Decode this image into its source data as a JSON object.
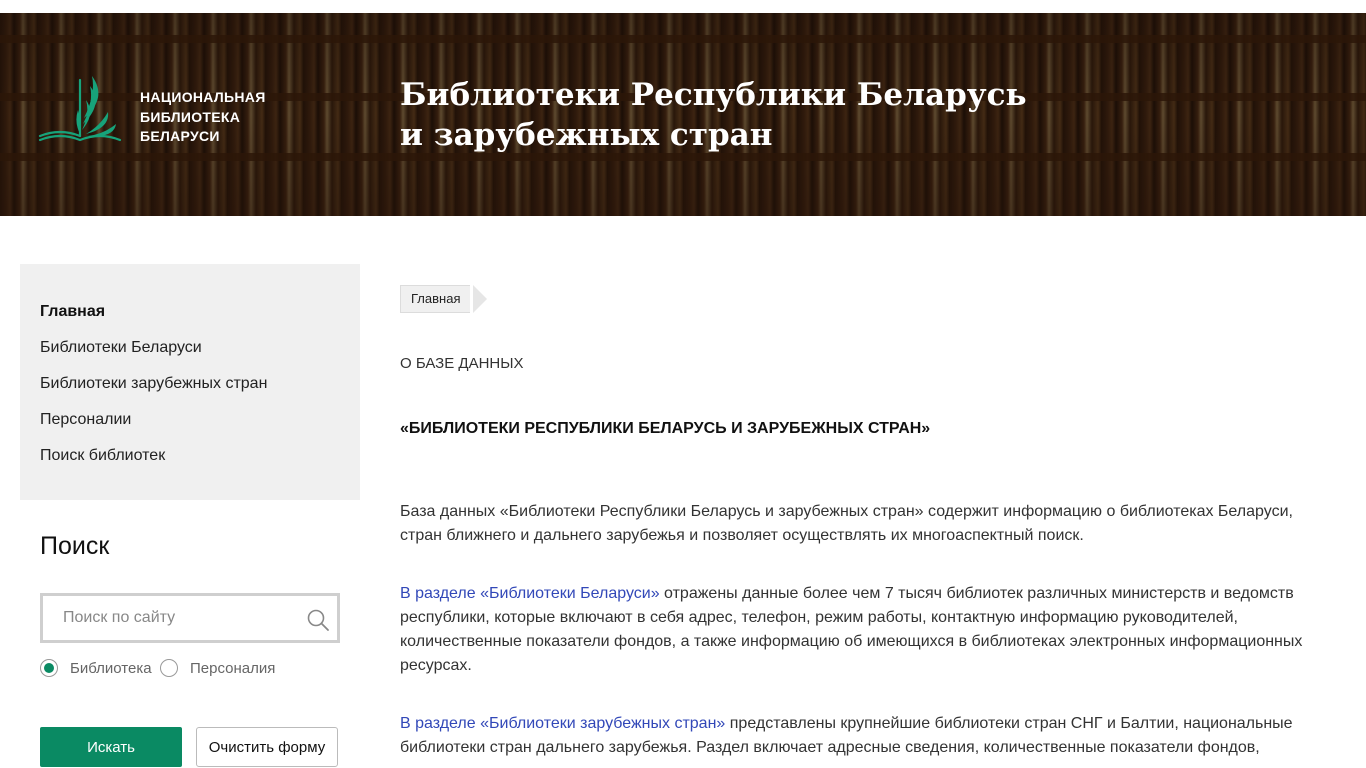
{
  "header": {
    "library_name": [
      "НАЦИОНАЛЬНАЯ",
      "БИБЛИОТЕКА",
      "БЕЛАРУСИ"
    ],
    "title_line1": "Библиотеки Республики Беларусь",
    "title_line2": "и зарубежных стран",
    "logo_color": "#17a37a"
  },
  "sidebar": {
    "items": [
      {
        "label": "Главная",
        "active": true
      },
      {
        "label": "Библиотеки Беларуси",
        "active": false
      },
      {
        "label": "Библиотеки зарубежных стран",
        "active": false
      },
      {
        "label": "Персоналии",
        "active": false
      },
      {
        "label": "Поиск библиотек",
        "active": false
      }
    ]
  },
  "search": {
    "title": "Поиск",
    "placeholder": "Поиск по сайту",
    "value": "",
    "icon": "search-icon",
    "options": [
      {
        "label": "Библиотека",
        "checked": true
      },
      {
        "label": "Персоналия",
        "checked": false
      }
    ],
    "submit_label": "Искать",
    "clear_label": "Очистить форму"
  },
  "breadcrumb": {
    "home": "Главная"
  },
  "main": {
    "about": "О БАЗЕ ДАННЫХ",
    "db_title": "«БИБЛИОТЕКИ РЕСПУБЛИКИ БЕЛАРУСЬ И ЗАРУБЕЖНЫХ СТРАН»",
    "p1": "База данных «Библиотеки Республики Беларусь и зарубежных стран» содержит информацию о библиотеках Беларуси, стран ближнего и дальнего зарубежья и позволяет осуществлять их многоаспектный поиск.",
    "p2_link": "В разделе «Библиотеки Беларуси»",
    "p2_text": " отражены данные более чем 7 тысяч библиотек различных министерств и ведомств республики, которые включают в себя адрес, телефон, режим работы, контактную информацию руководителей, количественные показатели фондов, а также информацию об имеющихся в библиотеках электронных информационных ресурсах.",
    "p3_link": "В разделе «Библиотеки зарубежных стран»",
    "p3_text": " представлены крупнейшие библиотеки стран СНГ и Балтии, национальные библиотеки стран дальнего зарубежья. Раздел включает адресные сведения, количественные показатели фондов,"
  },
  "colors": {
    "accent": "#0a8a63",
    "link": "#3248b8"
  }
}
